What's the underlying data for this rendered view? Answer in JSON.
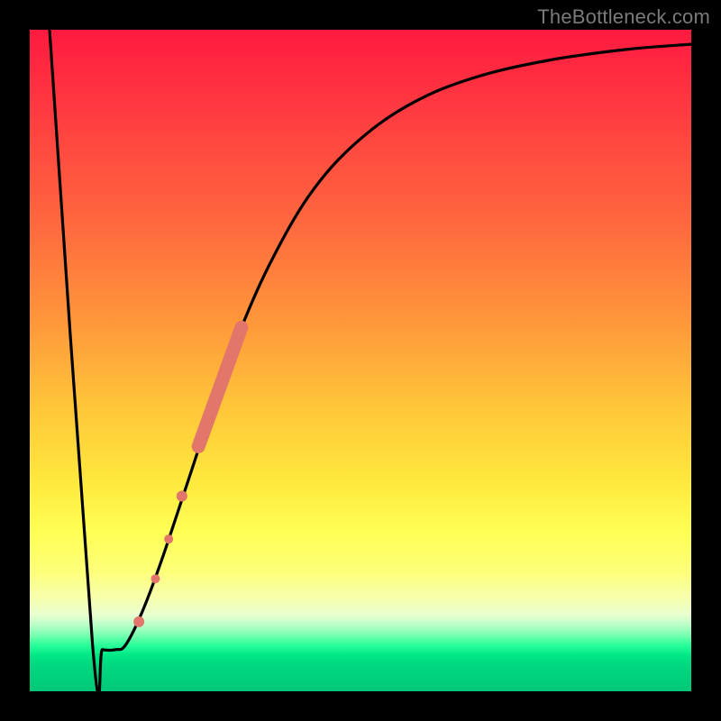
{
  "watermark": "TheBottleneck.com",
  "chart_data": {
    "type": "line",
    "title": "",
    "xlabel": "",
    "ylabel": "",
    "xlim": [
      0,
      100
    ],
    "ylim": [
      0,
      100
    ],
    "grid": false,
    "legend": false,
    "gradient_stops": [
      {
        "pct": 0,
        "color": "#ff1a3f"
      },
      {
        "pct": 30,
        "color": "#ff6a3e"
      },
      {
        "pct": 58,
        "color": "#ffc93a"
      },
      {
        "pct": 76,
        "color": "#ffff55"
      },
      {
        "pct": 90,
        "color": "#b8ffc8"
      },
      {
        "pct": 93,
        "color": "#2aff9a"
      },
      {
        "pct": 100,
        "color": "#00c878"
      }
    ],
    "series": [
      {
        "name": "bottleneck-curve",
        "color": "#000000",
        "points": [
          {
            "x": 3.0,
            "y": 100.0
          },
          {
            "x": 9.5,
            "y": 7.0
          },
          {
            "x": 11.0,
            "y": 6.3
          },
          {
            "x": 13.0,
            "y": 6.3
          },
          {
            "x": 14.5,
            "y": 7.0
          },
          {
            "x": 17.0,
            "y": 12.0
          },
          {
            "x": 20.0,
            "y": 20.0
          },
          {
            "x": 24.0,
            "y": 32.0
          },
          {
            "x": 28.0,
            "y": 44.0
          },
          {
            "x": 32.0,
            "y": 55.0
          },
          {
            "x": 37.0,
            "y": 66.0
          },
          {
            "x": 43.0,
            "y": 76.0
          },
          {
            "x": 50.0,
            "y": 83.5
          },
          {
            "x": 58.0,
            "y": 89.0
          },
          {
            "x": 67.0,
            "y": 92.7
          },
          {
            "x": 78.0,
            "y": 95.3
          },
          {
            "x": 90.0,
            "y": 97.0
          },
          {
            "x": 100.0,
            "y": 97.8
          }
        ]
      }
    ],
    "markers": {
      "name": "highlighted-points",
      "color": "#e2766a",
      "thick_segment": {
        "x0": 25.5,
        "y0": 37.0,
        "x1": 32.0,
        "y1": 55.0
      },
      "dots": [
        {
          "x": 23.0,
          "y": 29.5,
          "r": 6
        },
        {
          "x": 21.0,
          "y": 23.0,
          "r": 5
        },
        {
          "x": 19.0,
          "y": 17.0,
          "r": 5
        },
        {
          "x": 16.5,
          "y": 10.5,
          "r": 6
        }
      ]
    }
  }
}
